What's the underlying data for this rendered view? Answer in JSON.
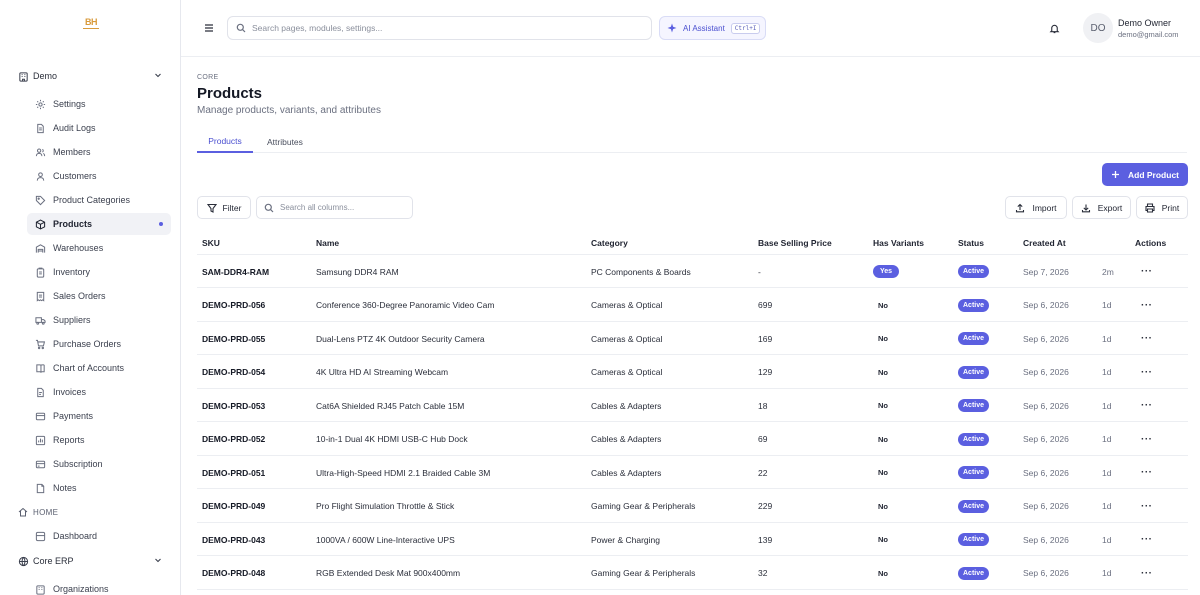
{
  "brand": {
    "logo_text": "BH"
  },
  "sidebar": {
    "group_demo": "Demo",
    "items": [
      {
        "label": "Settings",
        "icon": "gear-icon"
      },
      {
        "label": "Audit Logs",
        "icon": "file-text-icon"
      },
      {
        "label": "Members",
        "icon": "users-icon"
      },
      {
        "label": "Customers",
        "icon": "user-icon"
      },
      {
        "label": "Product Categories",
        "icon": "tag-icon"
      },
      {
        "label": "Products",
        "icon": "box-icon",
        "active": true
      },
      {
        "label": "Warehouses",
        "icon": "warehouse-icon"
      },
      {
        "label": "Inventory",
        "icon": "clipboard-icon"
      },
      {
        "label": "Sales Orders",
        "icon": "receipt-icon"
      },
      {
        "label": "Suppliers",
        "icon": "truck-icon"
      },
      {
        "label": "Purchase Orders",
        "icon": "cart-icon"
      },
      {
        "label": "Chart of Accounts",
        "icon": "book-icon"
      },
      {
        "label": "Invoices",
        "icon": "document-icon"
      },
      {
        "label": "Payments",
        "icon": "credit-card-icon"
      },
      {
        "label": "Reports",
        "icon": "chart-icon"
      },
      {
        "label": "Subscription",
        "icon": "card-icon"
      },
      {
        "label": "Notes",
        "icon": "note-icon"
      }
    ],
    "section_home": "HOME",
    "dashboard": "Dashboard",
    "group_core": "Core ERP",
    "organizations": "Organizations"
  },
  "topbar": {
    "search_placeholder": "Search pages, modules, settings...",
    "ai_label": "AI Assistant",
    "ai_shortcut": "Ctrl+I",
    "user_initials": "DO",
    "user_name": "Demo Owner",
    "user_email": "demo@gmail.com"
  },
  "page": {
    "breadcrumb": "CORE",
    "title": "Products",
    "subtitle": "Manage products, variants, and attributes",
    "tabs": [
      "Products",
      "Attributes"
    ],
    "add_label": "Add Product",
    "filter_label": "Filter",
    "column_search_placeholder": "Search all columns...",
    "import_label": "Import",
    "export_label": "Export",
    "print_label": "Print"
  },
  "table": {
    "headers": [
      "SKU",
      "Name",
      "Category",
      "Base Selling Price",
      "Has Variants",
      "Status",
      "Created At",
      "Actions"
    ],
    "rows": [
      {
        "sku": "SAM-DDR4-RAM",
        "name": "Samsung DDR4 RAM",
        "category": "PC Components & Boards",
        "price": "-",
        "variants": "Yes",
        "status": "Active",
        "created": "Sep 7, 2026",
        "age": "2m"
      },
      {
        "sku": "DEMO-PRD-056",
        "name": "Conference 360-Degree Panoramic Video Cam",
        "category": "Cameras & Optical",
        "price": "699",
        "variants": "No",
        "status": "Active",
        "created": "Sep 6, 2026",
        "age": "1d"
      },
      {
        "sku": "DEMO-PRD-055",
        "name": "Dual-Lens PTZ 4K Outdoor Security Camera",
        "category": "Cameras & Optical",
        "price": "169",
        "variants": "No",
        "status": "Active",
        "created": "Sep 6, 2026",
        "age": "1d"
      },
      {
        "sku": "DEMO-PRD-054",
        "name": "4K Ultra HD AI Streaming Webcam",
        "category": "Cameras & Optical",
        "price": "129",
        "variants": "No",
        "status": "Active",
        "created": "Sep 6, 2026",
        "age": "1d"
      },
      {
        "sku": "DEMO-PRD-053",
        "name": "Cat6A Shielded RJ45 Patch Cable 15M",
        "category": "Cables & Adapters",
        "price": "18",
        "variants": "No",
        "status": "Active",
        "created": "Sep 6, 2026",
        "age": "1d"
      },
      {
        "sku": "DEMO-PRD-052",
        "name": "10-in-1 Dual 4K HDMI USB-C Hub Dock",
        "category": "Cables & Adapters",
        "price": "69",
        "variants": "No",
        "status": "Active",
        "created": "Sep 6, 2026",
        "age": "1d"
      },
      {
        "sku": "DEMO-PRD-051",
        "name": "Ultra-High-Speed HDMI 2.1 Braided Cable 3M",
        "category": "Cables & Adapters",
        "price": "22",
        "variants": "No",
        "status": "Active",
        "created": "Sep 6, 2026",
        "age": "1d"
      },
      {
        "sku": "DEMO-PRD-049",
        "name": "Pro Flight Simulation Throttle & Stick",
        "category": "Gaming Gear & Peripherals",
        "price": "229",
        "variants": "No",
        "status": "Active",
        "created": "Sep 6, 2026",
        "age": "1d"
      },
      {
        "sku": "DEMO-PRD-043",
        "name": "1000VA / 600W Line-Interactive UPS",
        "category": "Power & Charging",
        "price": "139",
        "variants": "No",
        "status": "Active",
        "created": "Sep 6, 2026",
        "age": "1d"
      },
      {
        "sku": "DEMO-PRD-048",
        "name": "RGB Extended Desk Mat 900x400mm",
        "category": "Gaming Gear & Peripherals",
        "price": "32",
        "variants": "No",
        "status": "Active",
        "created": "Sep 6, 2026",
        "age": "1d"
      }
    ],
    "actions_glyph": "···"
  },
  "colors": {
    "accent": "#5b5fe0",
    "brand_logo": "#d89a3b"
  }
}
